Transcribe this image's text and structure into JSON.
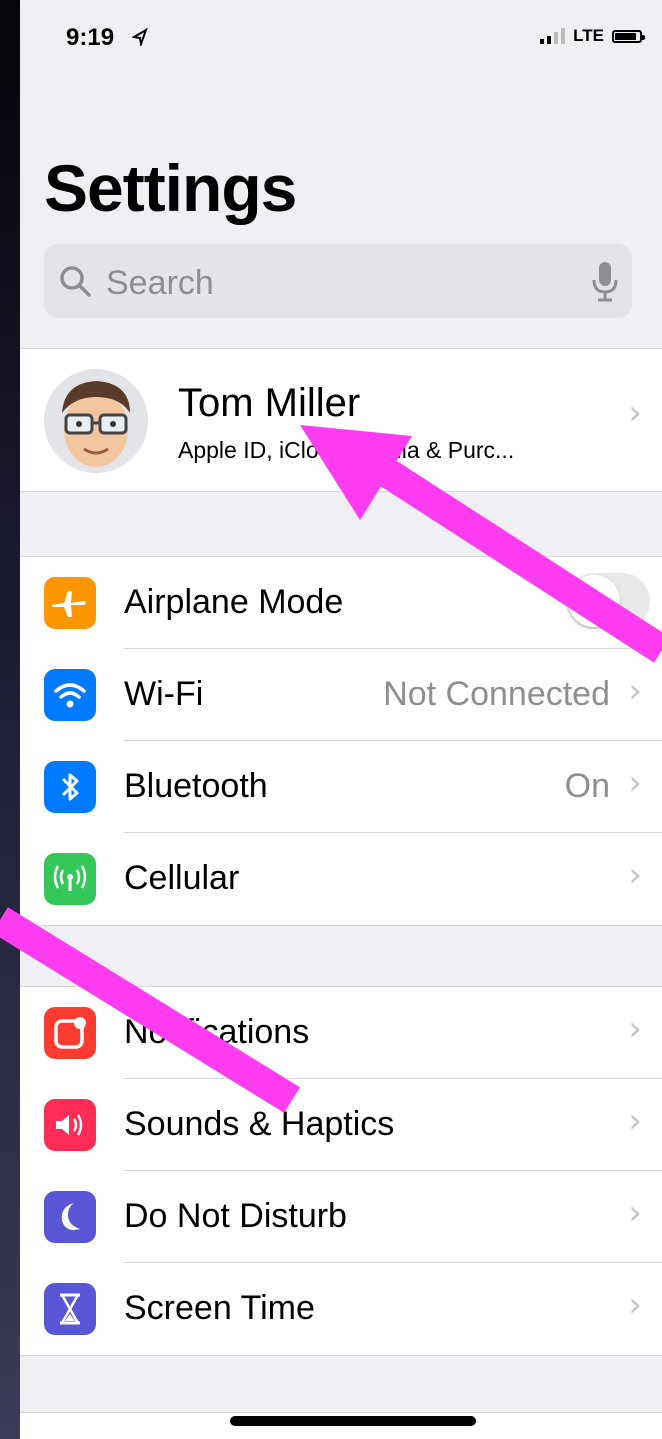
{
  "status_bar": {
    "time": "9:19",
    "network": "LTE"
  },
  "page_title": "Settings",
  "search": {
    "placeholder": "Search"
  },
  "profile": {
    "name": "Tom Miller",
    "subtitle": "Apple ID, iCloud, Media & Purc..."
  },
  "group1": [
    {
      "label": "Airplane Mode",
      "icon": "airplane-icon",
      "color": "#ff9500",
      "value": "",
      "toggle": true,
      "toggle_on": false
    },
    {
      "label": "Wi-Fi",
      "icon": "wifi-icon",
      "color": "#007aff",
      "value": "Not Connected"
    },
    {
      "label": "Bluetooth",
      "icon": "bluetooth-icon",
      "color": "#007aff",
      "value": "On"
    },
    {
      "label": "Cellular",
      "icon": "cellular-icon",
      "color": "#34c759",
      "value": ""
    }
  ],
  "group2": [
    {
      "label": "Notifications",
      "icon": "notifications-icon",
      "color": "#ff3b30"
    },
    {
      "label": "Sounds & Haptics",
      "icon": "speaker-icon",
      "color": "#ff2d55"
    },
    {
      "label": "Do Not Disturb",
      "icon": "moon-icon",
      "color": "#5856d6"
    },
    {
      "label": "Screen Time",
      "icon": "hourglass-icon",
      "color": "#5856d6"
    }
  ],
  "colors": {
    "background": "#efeff4",
    "annotation_arrow": "#ff3cf0"
  }
}
